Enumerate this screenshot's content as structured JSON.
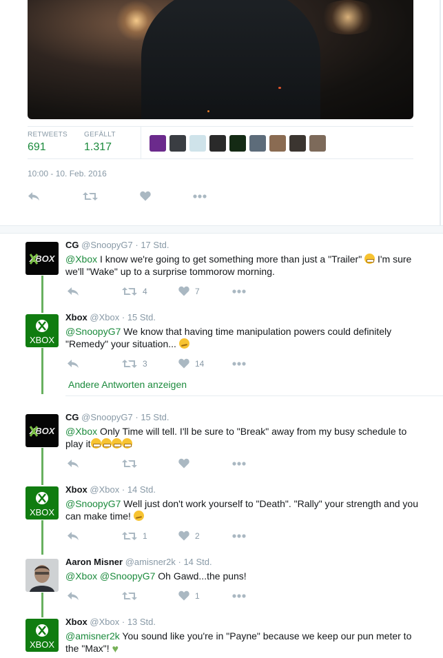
{
  "stats": {
    "retweets_label": "RETWEETS",
    "retweets_value": "691",
    "likes_label": "GEFÄLLT",
    "likes_value": "1.317"
  },
  "timestamp": "10:00 - 10. Feb. 2016",
  "liker_avatars": [
    {
      "name": "avatar-purple",
      "color": "#6b2a8c"
    },
    {
      "name": "avatar-dark-car",
      "color": "#3a3d42"
    },
    {
      "name": "avatar-blue-logo",
      "color": "#cfe3ea"
    },
    {
      "name": "avatar-text",
      "color": "#2a2a2a"
    },
    {
      "name": "avatar-green-dark",
      "color": "#142a14"
    },
    {
      "name": "avatar-landscape",
      "color": "#5d6c7a"
    },
    {
      "name": "avatar-person-outdoor",
      "color": "#8a6b52"
    },
    {
      "name": "avatar-group",
      "color": "#3b3530"
    },
    {
      "name": "avatar-man",
      "color": "#7d6a5a"
    }
  ],
  "colors": {
    "accent": "#1b8a3c",
    "thread_line": "#68b05f",
    "muted": "#8899a6"
  },
  "tweets": [
    {
      "name": "CG",
      "handle": "@SnoopyG7",
      "time": "· 17 Std.",
      "mention": "@Xbox",
      "text": " I know we're going to get something more than just a \"Trailer\" ",
      "text_after_emoji": " I'm sure we'll \"Wake\" up to a surprise tommorow morning.",
      "retweets": "4",
      "likes": "7"
    },
    {
      "name": "Xbox",
      "handle": "@Xbox",
      "time": "· 15 Std.",
      "mention": "@SnoopyG7",
      "text": " We know that having time manipulation powers could definitely \"Remedy\" your situation... ",
      "retweets": "3",
      "likes": "14"
    },
    {
      "name": "CG",
      "handle": "@SnoopyG7",
      "time": "· 15 Std.",
      "mention": "@Xbox",
      "text": " Only Time will tell. I'll  be sure to \"Break\" away from my busy schedule to play it",
      "retweets": "",
      "likes": ""
    },
    {
      "name": "Xbox",
      "handle": "@Xbox",
      "time": "· 14 Std.",
      "mention": "@SnoopyG7",
      "text": " Well just don't work yourself to \"Death\". \"Rally\" your strength and you can make time! ",
      "retweets": "1",
      "likes": "2"
    },
    {
      "name": "Aaron Misner",
      "handle": "@amisner2k",
      "time": "· 14 Std.",
      "mention": "@Xbox @SnoopyG7",
      "text": " Oh Gawd...the puns!",
      "retweets": "",
      "likes": "1"
    },
    {
      "name": "Xbox",
      "handle": "@Xbox",
      "time": "· 13 Std.",
      "mention": "@amisner2k",
      "text": " You sound like you're in \"Payne\" because we keep our pun meter to the \"Max\"! ",
      "retweets": "",
      "likes": ""
    }
  ],
  "more_replies": "Andere Antworten anzeigen",
  "xbox_logo_text": "XBOX",
  "cg_logo_text": "XBOX"
}
